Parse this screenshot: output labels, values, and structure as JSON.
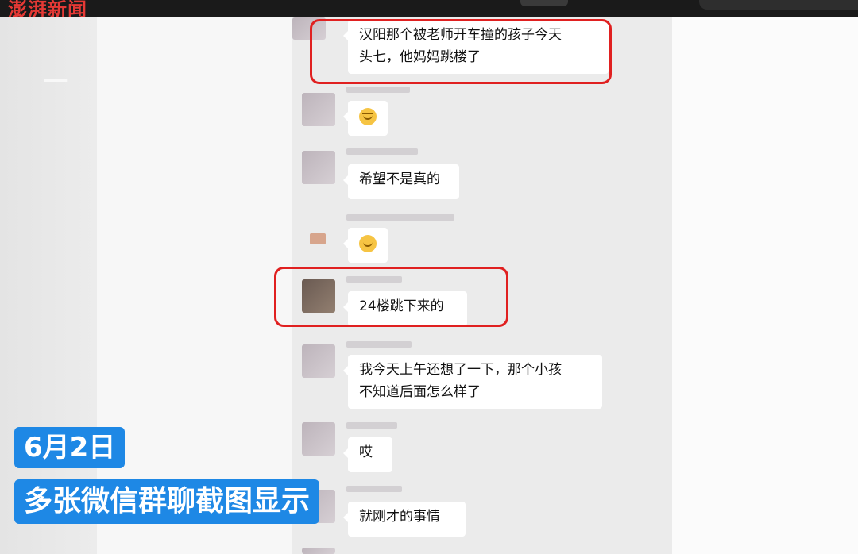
{
  "header": {
    "logo_text": "澎湃新闻"
  },
  "watermark": {
    "text": "一"
  },
  "messages": [
    {
      "text_line1": "汉阳那个被老师开车撞的孩子今天",
      "text_line2": "头七，他妈妈跳楼了",
      "highlighted": true
    },
    {
      "emoji": "angry-face-icon"
    },
    {
      "text": "希望不是真的"
    },
    {
      "emoji": "smile-face-icon"
    },
    {
      "text": "24楼跳下来的",
      "highlighted": true
    },
    {
      "text_line1": "我今天上午还想了一下，那个小孩",
      "text_line2": "不知道后面怎么样了"
    },
    {
      "text": "哎"
    },
    {
      "text": "就刚才的事情"
    }
  ],
  "captions": {
    "date": "6月2日",
    "subtitle": "多张微信群聊截图显示"
  },
  "colors": {
    "highlight": "#e02020",
    "caption_bg": "#1e88e5",
    "chat_bg": "#ebebeb"
  }
}
